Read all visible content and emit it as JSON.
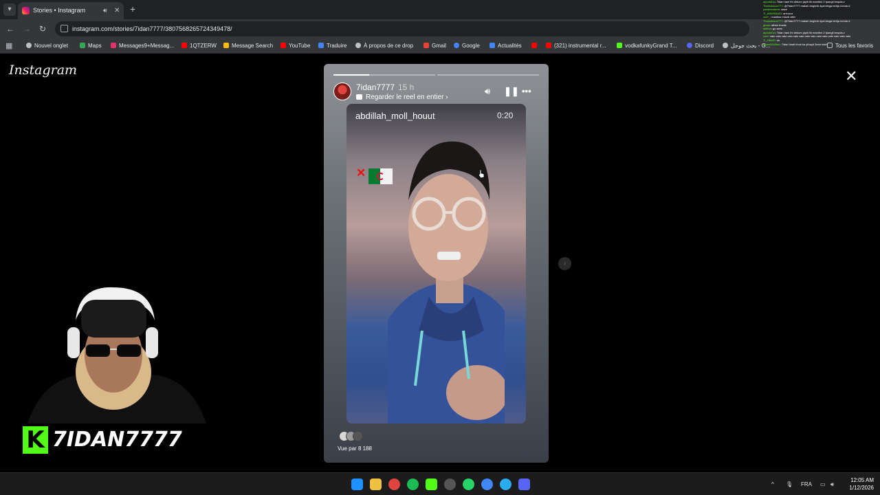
{
  "browser": {
    "tab_title": "Stories • Instagram",
    "url": "instagram.com/stories/7idan7777/3807568265724349478/",
    "bookmarks": [
      {
        "label": "Nouvel onglet",
        "color": "#bdc1c6"
      },
      {
        "label": "Maps",
        "color": "#34a853"
      },
      {
        "label": "Messages9+Messag...",
        "color": "#e1306c"
      },
      {
        "label": "1QTZERW",
        "color": "#ff0000"
      },
      {
        "label": "Message Search",
        "color": "#fbbc04"
      },
      {
        "label": "YouTube",
        "color": "#ff0000"
      },
      {
        "label": "Traduire",
        "color": "#4285f4"
      },
      {
        "label": "À propos de ce drop",
        "color": "#bdc1c6"
      },
      {
        "label": "Gmail",
        "color": "#ea4335"
      },
      {
        "label": "Google",
        "color": "#4285f4"
      },
      {
        "label": "Actualités",
        "color": "#4285f4"
      },
      {
        "label": "",
        "color": "#ff0000"
      },
      {
        "label": "(321) instrumental r...",
        "color": "#ff0000"
      },
      {
        "label": "vodkafunkyGrand T...",
        "color": "#53fc18"
      },
      {
        "label": "Discord",
        "color": "#5865f2"
      },
      {
        "label": "بحث جوجل - G...",
        "color": "#bdc1c6"
      }
    ],
    "all_bookmarks": "Tous les favoris"
  },
  "instagram": {
    "logo": "Instagram",
    "story": {
      "username": "7idan7777",
      "time": "15 h",
      "reel_link": "Regarder le reel en entier",
      "progress": [
        0.35,
        0,
        0
      ],
      "reel_username": "abdillah_moll_houut",
      "reel_duration": "0:20",
      "seen_by": "Vue par 8 188"
    }
  },
  "overlay": {
    "streamer_name": "7IDAN7777",
    "kick_letter": "K",
    "chat": [
      {
        "user": "ayoub61a",
        "msg": ": 7idan hani thi dirkom jayib lik manthni 2 tpangli bnqola.z"
      },
      {
        "user": "Thomalacox777",
        "msg": ": @7idan7777 makah tmghrib dyal kinga behja nchda d"
      },
      {
        "user": "yassinealachi",
        "msg": ": aaze"
      },
      {
        "user": "7I_AMUNNADI",
        "msg": ": arrrzzzz"
      },
      {
        "user": "user_",
        "msg": ": mantios mandi alter"
      },
      {
        "user": "Thomalacox777",
        "msg": ": @7idan7777 makah tmghrib dyal kinga behja nchda d"
      },
      {
        "user": "ghost",
        "msg": ": affam frostis"
      },
      {
        "user": "sofkha",
        "msg": ": go avec"
      },
      {
        "user": "ayoub61a",
        "msg": ": 7idan hani thi dirkom jayib lik manthni 2 tpangli bnqola.z"
      },
      {
        "user": "user",
        "msg": ": valo vaio valo vaio valo vaio valo vaio valo vaio valo vaio valo vaio"
      },
      {
        "user": "7I_OMAR",
        "msg": ": ok"
      },
      {
        "user": "adam2000bm",
        "msg": ": 7idan healt khok ka ythayd 3and dabi"
      }
    ]
  },
  "taskbar": {
    "language": "FRA",
    "time": "12:05 AM",
    "date": "1/12/2026"
  }
}
